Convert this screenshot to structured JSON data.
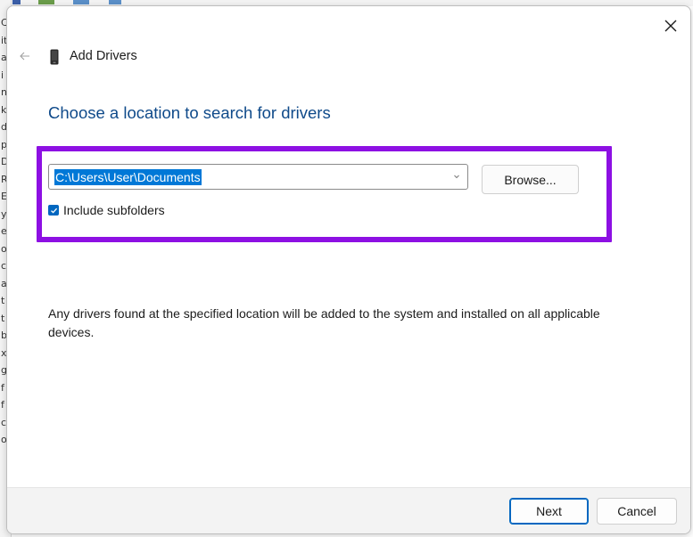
{
  "background_app": {
    "edge_chars": [
      "C",
      "it",
      "a",
      "i",
      "n",
      "k",
      "d",
      "p",
      "D",
      "",
      "R",
      "E",
      "y",
      "e",
      "o",
      "c",
      "a",
      "t",
      "t",
      "b",
      "x",
      "g",
      "f",
      "f",
      "c",
      "o"
    ]
  },
  "dialog": {
    "title": "Add Drivers",
    "heading": "Choose a location to search for drivers",
    "path_value": "C:\\Users\\User\\Documents",
    "browse_label": "Browse...",
    "include_subfolders_label": "Include subfolders",
    "include_subfolders_checked": true,
    "info_text": "Any drivers found at the specified location will be added to the system and installed on all applicable devices.",
    "next_label": "Next",
    "cancel_label": "Cancel"
  },
  "colors": {
    "heading": "#0f4a8a",
    "highlight_box": "#8d10e3",
    "accent": "#0067c0",
    "selection": "#0078d7"
  },
  "icons": {
    "close": "close-icon",
    "back": "back-arrow-icon",
    "device": "device-icon",
    "chevron": "chevron-down-icon",
    "check": "checkmark-icon"
  }
}
